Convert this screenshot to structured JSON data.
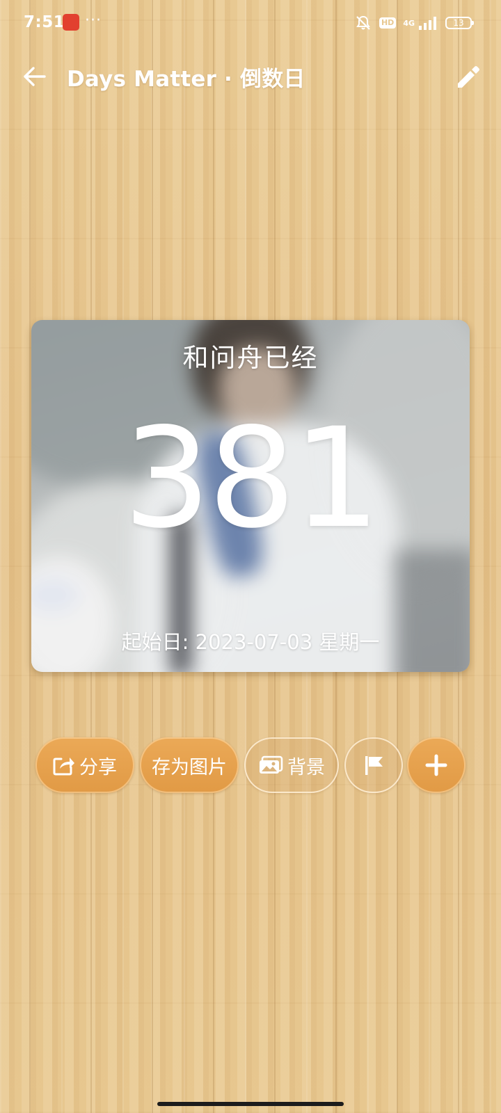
{
  "status_bar": {
    "time": "7:51",
    "dots": "···",
    "hd": "HD",
    "network": "4G",
    "battery": "13"
  },
  "app_bar": {
    "title": "Days Matter · 倒数日",
    "back_icon": "arrow-left-icon",
    "edit_icon": "pencil-icon"
  },
  "card": {
    "event_title": "和问舟已经",
    "day_count": "381",
    "start_date": "起始日: 2023-07-03 星期一"
  },
  "actions": {
    "share_label": "分享",
    "save_image_label": "存为图片",
    "background_label": "背景",
    "flag_icon": "flag-icon",
    "add_icon": "plus-icon"
  },
  "colors": {
    "wood": "#e6c58e",
    "button_orange": "#e5a04c",
    "text": "#ffffff"
  }
}
